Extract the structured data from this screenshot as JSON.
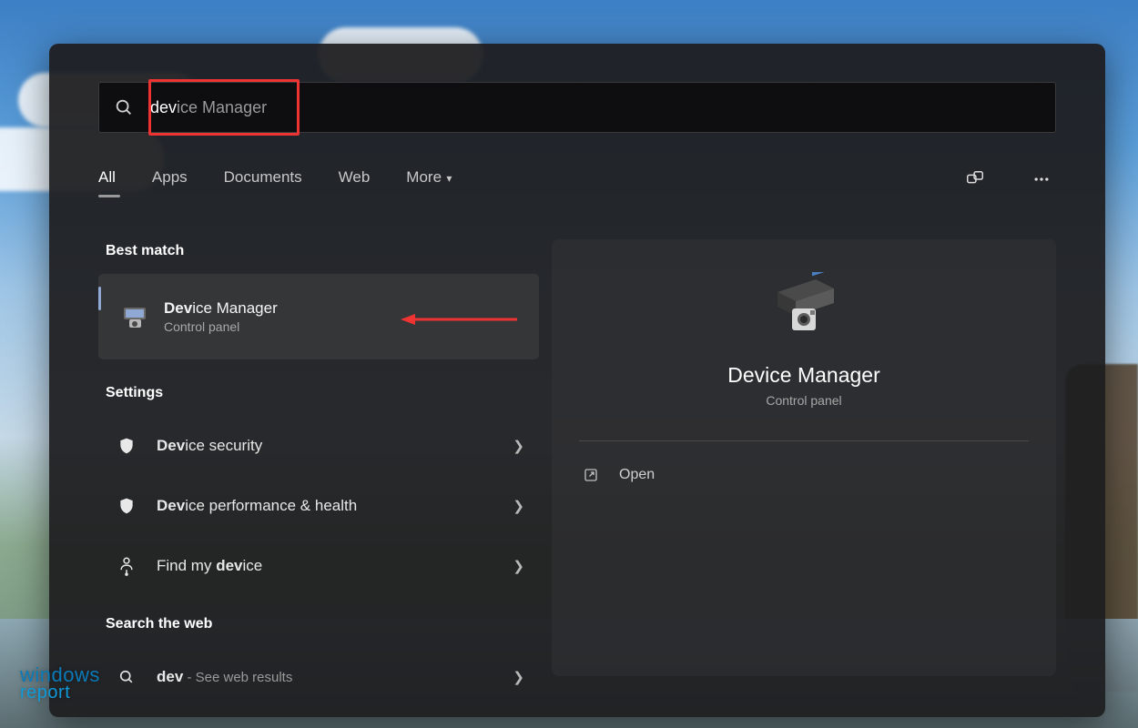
{
  "search": {
    "query_bold": "dev",
    "query_rest": "ice Manager"
  },
  "tabs": {
    "all": "All",
    "apps": "Apps",
    "documents": "Documents",
    "web": "Web",
    "more": "More"
  },
  "sections": {
    "best_match": "Best match",
    "settings": "Settings",
    "search_web": "Search the web"
  },
  "best_match": {
    "title_bold": "Dev",
    "title_rest": "ice Manager",
    "subtitle": "Control panel"
  },
  "settings_items": [
    {
      "bold": "Dev",
      "rest": "ice security",
      "icon": "shield"
    },
    {
      "bold": "Dev",
      "rest": "ice performance & health",
      "icon": "shield"
    },
    {
      "pre": "Find my ",
      "bold": "dev",
      "rest": "ice",
      "icon": "person-pin"
    }
  ],
  "web_search": {
    "bold": "dev",
    "rest": " - See web results"
  },
  "preview": {
    "title": "Device Manager",
    "subtitle": "Control panel",
    "open": "Open"
  },
  "watermark": {
    "line1": "windows",
    "line2": "report"
  }
}
